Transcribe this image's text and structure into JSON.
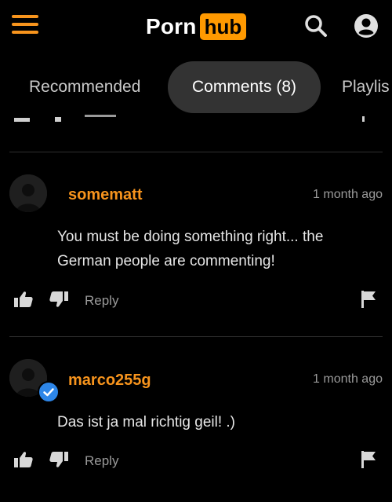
{
  "header": {
    "logo_part1": "Porn",
    "logo_part2": "hub",
    "menu_icon": "hamburger-menu-icon",
    "search_icon": "search-icon",
    "user_icon": "user-account-icon",
    "accent_color": "#f7941d"
  },
  "tabs": [
    {
      "label": "Recommended",
      "active": false
    },
    {
      "label": "Comments (8)",
      "active": true
    },
    {
      "label": "Playlis",
      "active": false
    }
  ],
  "comments": [
    {
      "username": "somematt",
      "time": "1 month ago",
      "text": "You must be doing something right... the German people are commenting!",
      "reply_label": "Reply",
      "verified": false
    },
    {
      "username": "marco255g",
      "time": "1 month ago",
      "text": "Das ist ja mal richtig geil! .)",
      "reply_label": "Reply",
      "verified": true
    }
  ]
}
